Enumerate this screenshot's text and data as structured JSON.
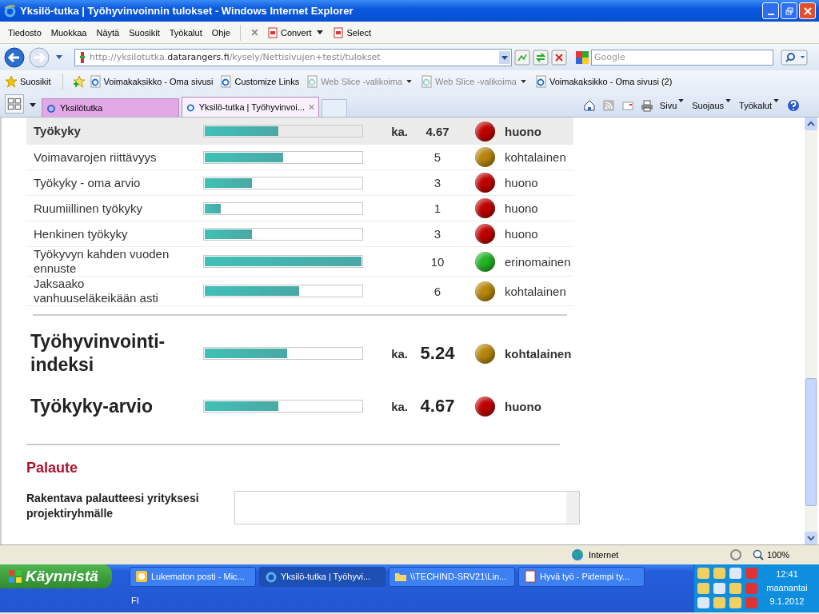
{
  "window": {
    "title": "Yksilö-tutka | Työhyvinvoinnin tulokset - Windows Internet Explorer"
  },
  "menu": [
    "Tiedosto",
    "Muokkaa",
    "Näytä",
    "Suosikit",
    "Työkalut",
    "Ohje"
  ],
  "toolbar": [
    {
      "label": "Convert",
      "dropdown": true
    },
    {
      "label": "Select",
      "dropdown": false
    }
  ],
  "address": {
    "prefix": "http://yksilotutka.",
    "domain": "datarangers.fi",
    "path": "/kysely/Nettisivujen+testi/tulokset"
  },
  "search": {
    "placeholder": "Google"
  },
  "favorites": {
    "label": "Suosikit",
    "links": [
      {
        "label": "Voimakaksikko - Oma sivusi",
        "kind": "page"
      },
      {
        "label": "Customize Links",
        "kind": "page"
      },
      {
        "label": "Web Slice -valikoima",
        "kind": "webslice"
      },
      {
        "label": "Web Slice -valikoima",
        "kind": "webslice"
      },
      {
        "label": "Voimakaksikko - Oma sivusi (2)",
        "kind": "page"
      }
    ]
  },
  "tabs": [
    {
      "label": "Yksilötutka",
      "selected": false
    },
    {
      "label": "Yksilö-tutka | Työhyvinvoi...",
      "selected": true
    }
  ],
  "commands": [
    "Sivu",
    "Suojaus",
    "Työkalut"
  ],
  "summary": {
    "name": "Työkyky",
    "level": 0.467,
    "avg_label": "ka.",
    "value": "4.67",
    "color": "#c00000",
    "rating": "huono"
  },
  "rows": [
    {
      "name": "Voimavarojen riittävyys",
      "level": 0.5,
      "value": "5",
      "color": "#b8860b",
      "rating": "kohtalainen"
    },
    {
      "name": "Työkyky - oma arvio",
      "level": 0.3,
      "value": "3",
      "color": "#c00000",
      "rating": "huono"
    },
    {
      "name": "Ruumiillinen työkyky",
      "level": 0.1,
      "value": "1",
      "color": "#c00000",
      "rating": "huono"
    },
    {
      "name": "Henkinen työkyky",
      "level": 0.3,
      "value": "3",
      "color": "#c00000",
      "rating": "huono"
    },
    {
      "name": "Työkyvyn kahden vuoden ennuste",
      "level": 1,
      "value": "10",
      "color": "#22b422",
      "rating": "erinomainen"
    },
    {
      "name": "Jaksaako vanhuuseläkeikään asti",
      "level": 0.6,
      "value": "6",
      "color": "#b8860b",
      "rating": "kohtalainen"
    }
  ],
  "indices": [
    {
      "name": "Työhyvinvointi-indeksi",
      "level": 0.524,
      "avg_label": "ka.",
      "value": "5.24",
      "color": "#b8860b",
      "rating": "kohtalainen"
    },
    {
      "name": "Työkyky-arvio",
      "level": 0.467,
      "avg_label": "ka.",
      "value": "4.67",
      "color": "#c00000",
      "rating": "huono"
    }
  ],
  "feedback": {
    "heading": "Palaute",
    "label": "Rakentava palautteesi yrityksesi projektiryhmälle"
  },
  "status": {
    "zone": "Internet",
    "zoom": "100%"
  },
  "taskbar": {
    "start": "Käynnistä",
    "tasks": [
      {
        "label": "Lukematon posti - Mic...",
        "kind": "mail",
        "selected": false
      },
      {
        "label": "Yksilö-tutka | Työhyvi...",
        "kind": "browser",
        "selected": true
      },
      {
        "label": "\\\\TECHIND-SRV21\\Lin...",
        "kind": "folder",
        "selected": false
      },
      {
        "label": "Hyvä työ - Pidempi ty...",
        "kind": "doc",
        "selected": false
      }
    ],
    "language": "FI",
    "time": "12:41",
    "day": "maanantai",
    "date": "9.1.2012"
  }
}
